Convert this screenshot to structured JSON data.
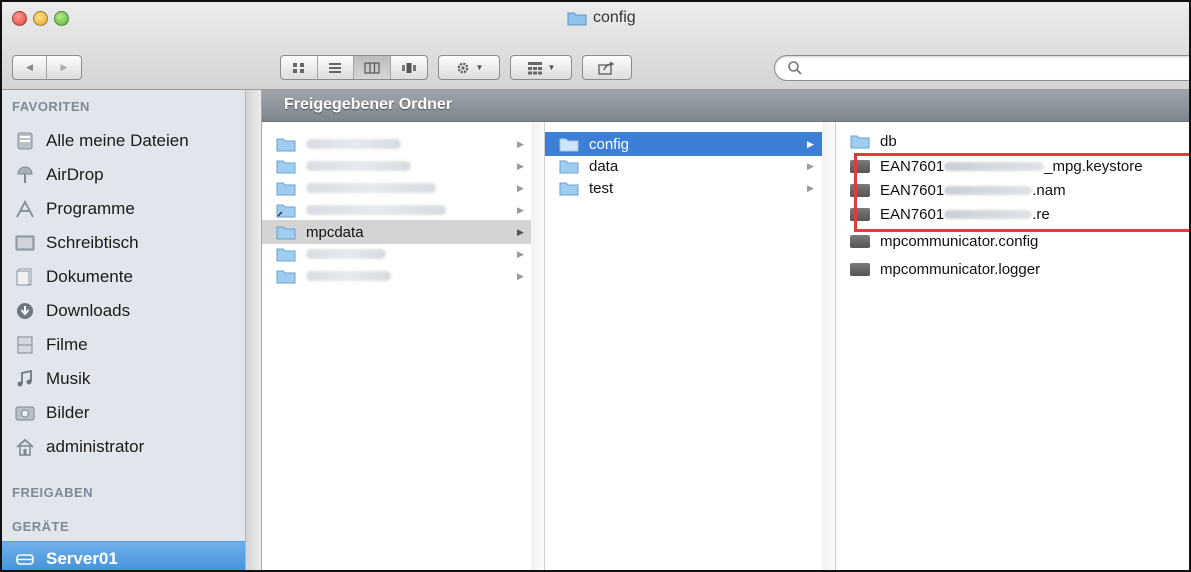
{
  "window": {
    "title": "config"
  },
  "toolbar": {
    "back_label": "◀",
    "forward_label": "▶",
    "search": {
      "value": "",
      "placeholder": ""
    }
  },
  "sidebar": {
    "favorites_heading": "FAVORITEN",
    "shared_heading": "FREIGABEN",
    "devices_heading": "GERÄTE",
    "favorites": [
      {
        "label": "Alle meine Dateien",
        "icon": "all-files-icon"
      },
      {
        "label": "AirDrop",
        "icon": "airdrop-icon"
      },
      {
        "label": "Programme",
        "icon": "applications-icon"
      },
      {
        "label": "Schreibtisch",
        "icon": "desktop-icon"
      },
      {
        "label": "Dokumente",
        "icon": "documents-icon"
      },
      {
        "label": "Downloads",
        "icon": "downloads-icon"
      },
      {
        "label": "Filme",
        "icon": "movies-icon"
      },
      {
        "label": "Musik",
        "icon": "music-icon"
      },
      {
        "label": "Bilder",
        "icon": "pictures-icon"
      },
      {
        "label": "administrator",
        "icon": "home-icon"
      }
    ],
    "devices": [
      {
        "label": "Server01",
        "icon": "server-icon",
        "selected": true
      }
    ]
  },
  "browser": {
    "header": "Freigegebener Ordner",
    "column1": {
      "items": [
        {
          "label": "",
          "blurred": true
        },
        {
          "label": "",
          "blurred": true
        },
        {
          "label": "",
          "blurred": true
        },
        {
          "label": "",
          "blurred": true,
          "alias": true
        },
        {
          "label": "mpcdata",
          "blurred": false,
          "selected": "inactive"
        },
        {
          "label": "",
          "blurred": true
        },
        {
          "label": "",
          "blurred": true
        }
      ]
    },
    "column2": {
      "items": [
        {
          "label": "config",
          "selected": "active"
        },
        {
          "label": "data"
        },
        {
          "label": "test"
        }
      ]
    },
    "column3": {
      "items": [
        {
          "label": "db",
          "kind": "folder"
        },
        {
          "prefix": "EAN7601",
          "suffix": "_mpg.keystore",
          "kind": "file",
          "redacted": true
        },
        {
          "prefix": "EAN7601",
          "suffix": ".nam",
          "kind": "file",
          "redacted": true
        },
        {
          "prefix": "EAN7601",
          "suffix": ".re",
          "kind": "file",
          "redacted": true
        },
        {
          "label": "mpcommunicator.config",
          "kind": "file"
        },
        {
          "label": "mpcommunicator.logger",
          "kind": "file"
        }
      ]
    }
  },
  "colors": {
    "selection_active": "#3d7fd6",
    "selection_inactive": "#d4d4d4",
    "highlight_border": "#e23b3b",
    "sidebar_bg": "#e1e6ed"
  }
}
